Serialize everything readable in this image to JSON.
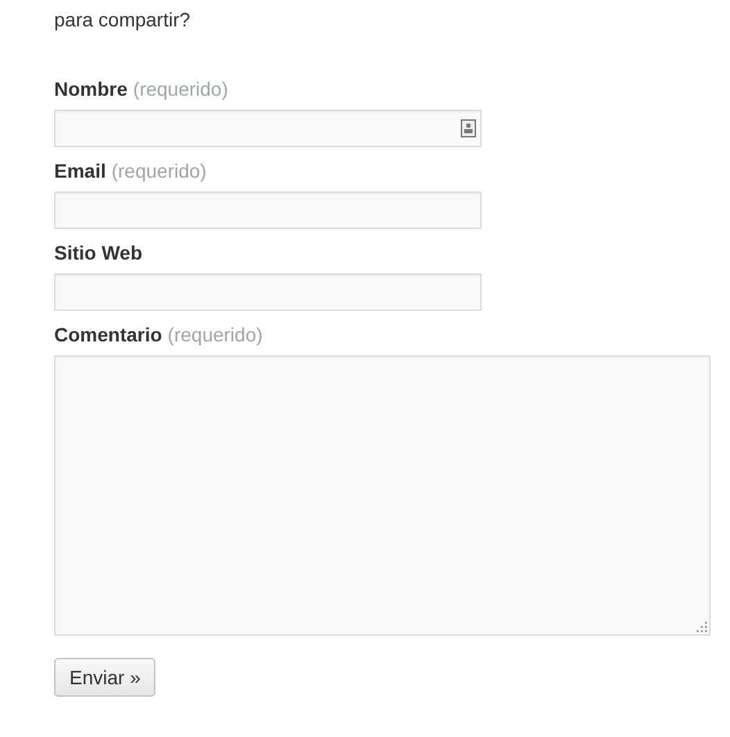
{
  "intro": "para compartir?",
  "fields": [
    {
      "kind": "text",
      "label": "Nombre",
      "note": "(requerido)",
      "autofill": true
    },
    {
      "kind": "text",
      "label": "Email",
      "note": "(requerido)"
    },
    {
      "kind": "text",
      "label": "Sitio Web"
    },
    {
      "kind": "textarea",
      "label": "Comentario",
      "note": "(requerido)"
    }
  ],
  "submit": "Enviar »"
}
